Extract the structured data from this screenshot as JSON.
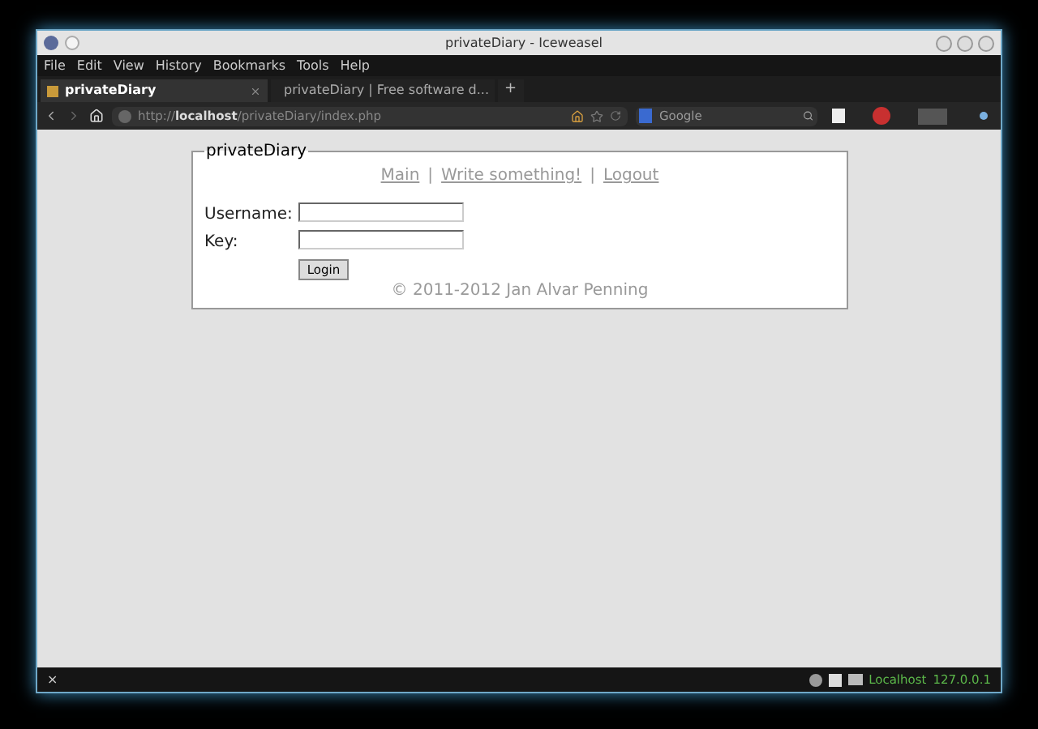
{
  "window": {
    "title": "privateDiary - Iceweasel"
  },
  "menu": [
    "File",
    "Edit",
    "View",
    "History",
    "Bookmarks",
    "Tools",
    "Help"
  ],
  "tabs": [
    {
      "label": "privateDiary",
      "selected": true
    },
    {
      "label": "privateDiary | Free software d...",
      "selected": false
    }
  ],
  "new_tab": "+",
  "address": {
    "value": "http://**localhost**/privateDiary/index.php"
  },
  "search": {
    "placeholder": "Google"
  },
  "page": {
    "legend": "privateDiary",
    "links": [
      "Main",
      "Write something!",
      "Logout"
    ],
    "separator": "|",
    "fields": [
      {
        "label": "Username:"
      },
      {
        "label": "Key:"
      }
    ],
    "button": "Login",
    "footer": "© 2011-2012 Jan Alvar Penning"
  },
  "status_bar": {
    "close": "×",
    "host": "Localhost",
    "ip": "127.0.0.1"
  }
}
